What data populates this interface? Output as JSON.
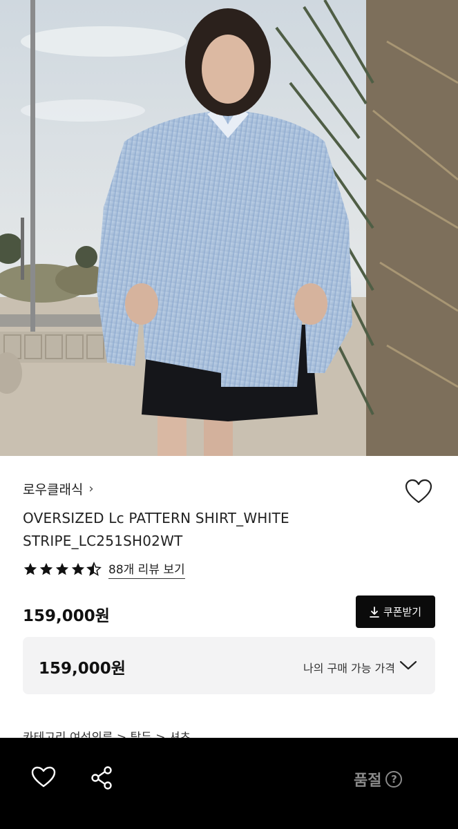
{
  "product": {
    "brand": "로우클래식",
    "brand_chevron": "›",
    "title": "OVERSIZED Lc PATTERN SHIRT_WHITE STRIPE_LC251SH02WT",
    "rating": 4.5,
    "review_link": "88개 리뷰 보기",
    "price": "159,000원"
  },
  "coupon": {
    "label": "쿠폰받기"
  },
  "my_price": {
    "value": "159,000원",
    "label": "나의 구매 가능 가격"
  },
  "breadcrumb_peek": "카테고리     여성의류 > 탑두 > 셔츠",
  "bottom_bar": {
    "status": "품절",
    "help": "?"
  },
  "icons": {
    "wishlist": "heart-icon",
    "share": "share-icon",
    "download": "download-icon",
    "expand": "chevron-down-icon"
  },
  "colors": {
    "accent": "#0b0b0b",
    "bar": "#000000",
    "disabled": "#8a8a8a",
    "panel": "#f3f3f4"
  }
}
